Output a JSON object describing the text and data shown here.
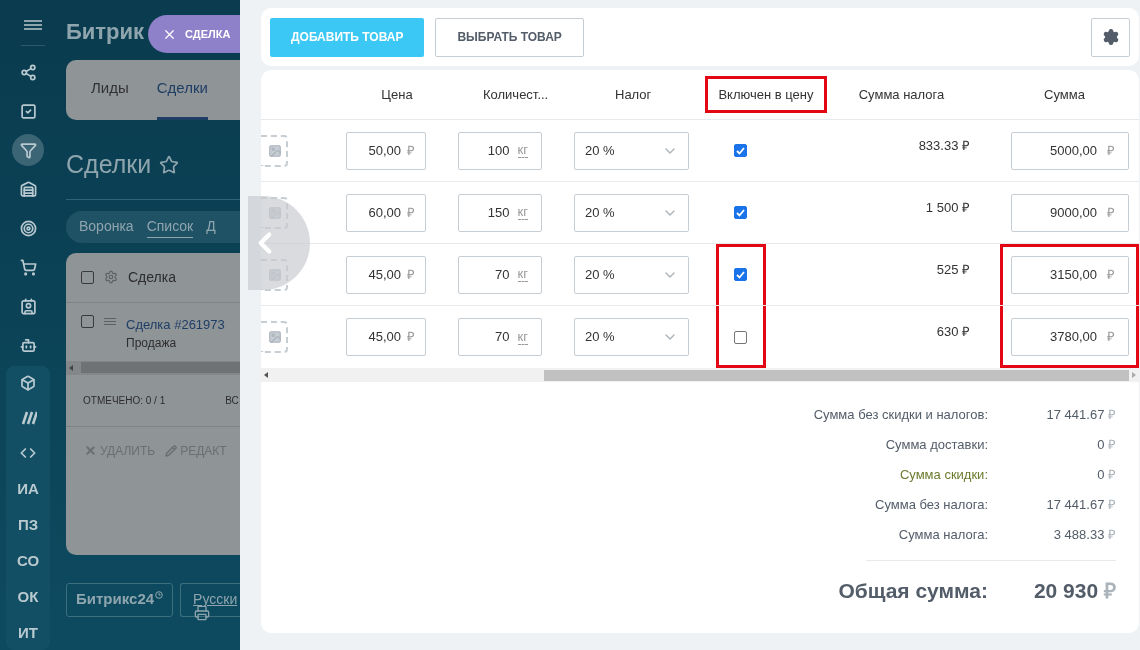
{
  "sidebar": {
    "icon_items": [
      {
        "selected": false
      },
      {
        "selected": false
      },
      {
        "selected": true
      },
      {
        "selected": false
      },
      {
        "selected": false
      },
      {
        "selected": false
      },
      {
        "selected": false
      },
      {
        "selected": false
      }
    ],
    "group_icons": [
      {
        "selected": false
      },
      {
        "selected": false
      },
      {
        "selected": false
      }
    ],
    "group_labels": [
      {
        "label": "ИА"
      },
      {
        "label": "ПЗ"
      },
      {
        "label": "СО"
      },
      {
        "label": "ОК"
      },
      {
        "label": "ИТ"
      }
    ]
  },
  "backdrop": {
    "logo": "Битрик",
    "header_checked": false,
    "row_checked": false,
    "tabs": [
      {
        "label": "Лиды",
        "selected": false
      },
      {
        "label": "Сделки",
        "selected": true
      }
    ],
    "title": "Сделки",
    "views": [
      {
        "label": "Воронка",
        "selected": false
      },
      {
        "label": "Список",
        "selected": true
      },
      {
        "label": "Д",
        "selected": false
      }
    ],
    "grid_header": "Сделка",
    "deal_link": "Сделка #261973",
    "deal_stage": "Продажа",
    "selected_count": "ОТМЕЧЕНО: 0 / 1",
    "column_cut": "ВС",
    "actions": [
      {
        "kind": "delete",
        "label": "УДАЛИТЬ"
      },
      {
        "kind": "edit",
        "label": "РЕДАКТ"
      }
    ],
    "footer_logo": "Битрикс24",
    "footer_language": "Русски"
  },
  "slider_label": "СДЕЛКА",
  "toolbar": {
    "add_button": "ДОБАВИТЬ ТОВАР",
    "select_button": "ВЫБРАТЬ ТОВАР"
  },
  "table": {
    "columns": [
      {
        "label": "Цена",
        "highlighted": false
      },
      {
        "label": "Количест...",
        "highlighted": false
      },
      {
        "label": "Налог",
        "highlighted": false
      },
      {
        "label": "Включен в цену",
        "highlighted": true
      },
      {
        "label": "Сумма налога",
        "highlighted": false
      },
      {
        "label": "Сумма",
        "highlighted": false
      }
    ],
    "rows": [
      {
        "price": "50,00",
        "currency": "₽",
        "quantity": "100",
        "unit": "кг",
        "tax": "20 %",
        "included": true,
        "tax_sum": "833.33 ₽",
        "sum": "5000,00",
        "sum_currency": "₽",
        "marked": false
      },
      {
        "price": "60,00",
        "currency": "₽",
        "quantity": "150",
        "unit": "кг",
        "tax": "20 %",
        "included": true,
        "tax_sum": "1 500 ₽",
        "sum": "9000,00",
        "sum_currency": "₽",
        "marked": false
      },
      {
        "price": "45,00",
        "currency": "₽",
        "quantity": "70",
        "unit": "кг",
        "tax": "20 %",
        "included": true,
        "tax_sum": "525 ₽",
        "sum": "3150,00",
        "sum_currency": "₽",
        "marked": true
      },
      {
        "price": "45,00",
        "currency": "₽",
        "quantity": "70",
        "unit": "кг",
        "tax": "20 %",
        "included": false,
        "tax_sum": "630 ₽",
        "sum": "3780,00",
        "sum_currency": "₽",
        "marked": true
      }
    ]
  },
  "totals": [
    {
      "kind": "plain",
      "label": "Сумма без скидки и налогов:",
      "value": "17 441.67",
      "currency": "₽"
    },
    {
      "kind": "plain",
      "label": "Сумма доставки:",
      "value": "0",
      "currency": "₽"
    },
    {
      "kind": "discount",
      "label": "Сумма скидки:",
      "value": "0",
      "currency": "₽"
    },
    {
      "kind": "plain",
      "label": "Сумма без налога:",
      "value": "17 441.67",
      "currency": "₽"
    },
    {
      "kind": "plain",
      "label": "Сумма налога:",
      "value": "3 488.33",
      "currency": "₽"
    }
  ],
  "grand_total": {
    "label": "Общая сумма:",
    "value": "20 930",
    "currency": "₽"
  }
}
